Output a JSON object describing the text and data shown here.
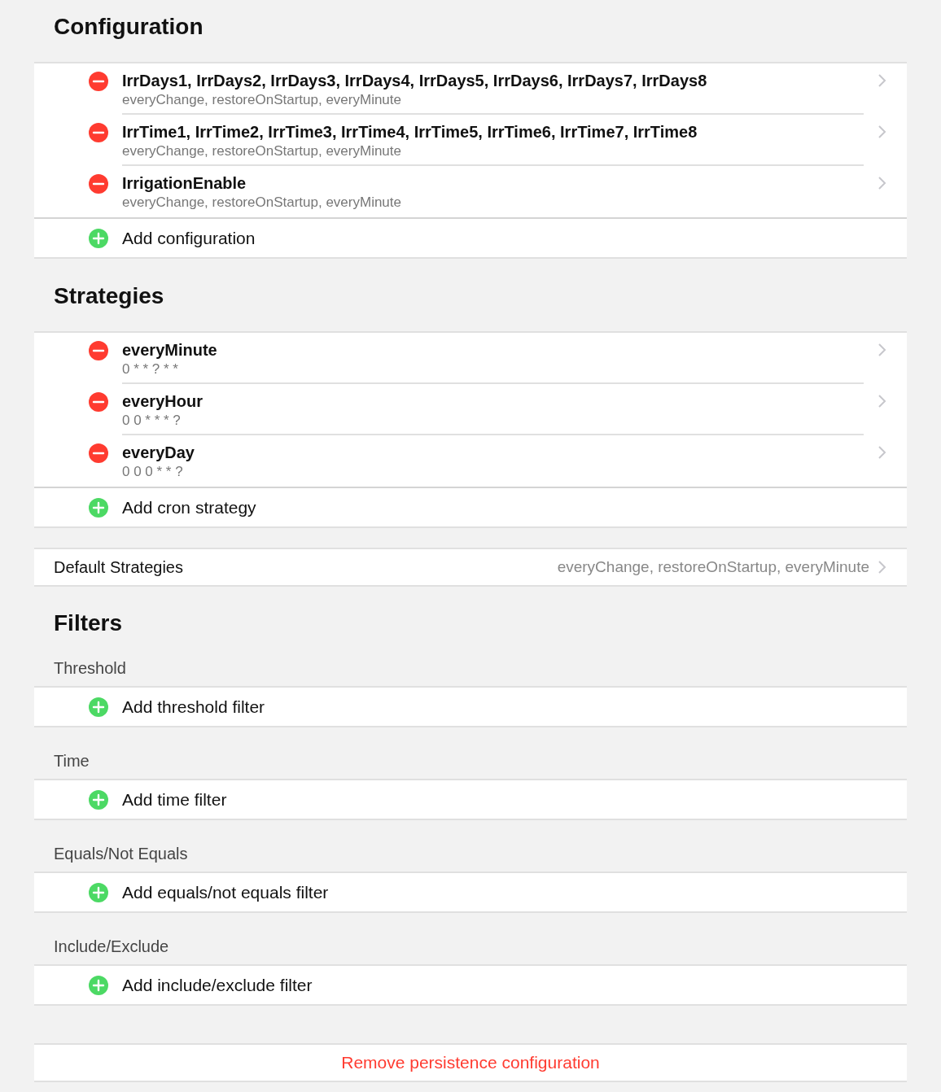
{
  "sections": [
    {
      "title": "Configuration",
      "items": [
        {
          "title": "IrrDays1, IrrDays2, IrrDays3, IrrDays4, IrrDays5, IrrDays6, IrrDays7, IrrDays8",
          "subtitle": "everyChange, restoreOnStartup, everyMinute"
        },
        {
          "title": "IrrTime1, IrrTime2, IrrTime3, IrrTime4, IrrTime5, IrrTime6, IrrTime7, IrrTime8",
          "subtitle": "everyChange, restoreOnStartup, everyMinute"
        },
        {
          "title": "IrrigationEnable",
          "subtitle": "everyChange, restoreOnStartup, everyMinute"
        }
      ],
      "add_label": "Add configuration"
    },
    {
      "title": "Strategies",
      "items": [
        {
          "title": "everyMinute",
          "subtitle": "0 * * ? * *"
        },
        {
          "title": "everyHour",
          "subtitle": "0 0 * * * ?"
        },
        {
          "title": "everyDay",
          "subtitle": "0 0 0 * * ?"
        }
      ],
      "add_label": "Add cron strategy"
    }
  ],
  "default_strategies": {
    "label": "Default Strategies",
    "value": "everyChange, restoreOnStartup, everyMinute"
  },
  "filters": {
    "title": "Filters",
    "groups": [
      {
        "label": "Threshold",
        "add_label": "Add threshold filter"
      },
      {
        "label": "Time",
        "add_label": "Add time filter"
      },
      {
        "label": "Equals/Not Equals",
        "add_label": "Add equals/not equals filter"
      },
      {
        "label": "Include/Exclude",
        "add_label": "Add include/exclude filter"
      }
    ]
  },
  "remove_button": "Remove persistence configuration"
}
